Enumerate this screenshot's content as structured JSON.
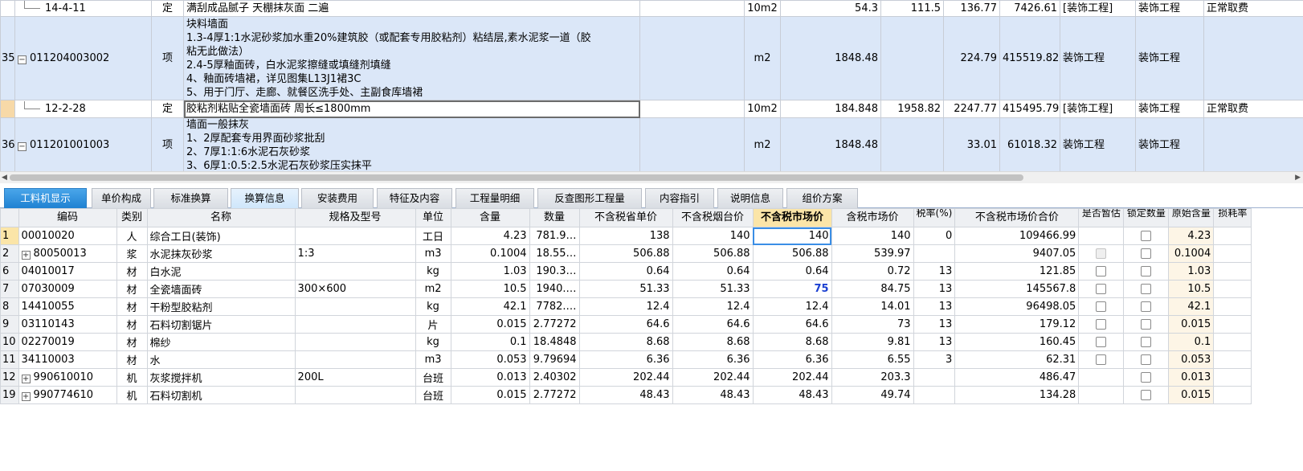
{
  "top_grid": {
    "rows": [
      {
        "idx": "",
        "code": "14-4-11",
        "kind": "定",
        "name": [
          "满刮成品腻子 天棚抹灰面 二遍"
        ],
        "unit": "10m2",
        "qty": "54.3",
        "price": "111.5",
        "total_unit": "136.77",
        "total": "7426.61",
        "category": "[装饰工程]",
        "major": "装饰工程",
        "fee": "正常取费",
        "style": "white",
        "tree": "line"
      },
      {
        "idx": "35",
        "code": "011204003002",
        "kind": "项",
        "name": [
          "块料墙面",
          "1.3-4厚1:1水泥砂浆加水重20%建筑胶（或配套专用胶粘剂）粘结层,素水泥浆一道（胶",
          "粘无此做法）",
          "2.4-5厚釉面砖，白水泥浆擦缝或填缝剂填缝",
          "4、釉面砖墙裙，详见图集L13J1裙3C",
          "5、用于门厅、走廊、就餐区洗手处、主副食库墙裙"
        ],
        "unit": "m2",
        "qty": "1848.48",
        "price": "",
        "total_unit": "224.79",
        "total": "415519.82",
        "category": "装饰工程",
        "major": "装饰工程",
        "fee": "",
        "style": "blue",
        "tree": "minus"
      },
      {
        "idx": "",
        "code": "12-2-28",
        "kind": "定",
        "name": [
          "胶粘剂粘贴全瓷墙面砖 周长≤1800mm"
        ],
        "unit": "10m2",
        "qty": "184.848",
        "price": "1958.82",
        "total_unit": "2247.77",
        "total": "415495.79",
        "category": "[装饰工程]",
        "major": "装饰工程",
        "fee": "正常取费",
        "style": "white",
        "tree": "line"
      },
      {
        "idx": "36",
        "code": "011201001003",
        "kind": "项",
        "name": [
          "墙面一般抹灰",
          "1、2厚配套专用界面砂浆批刮",
          "2、7厚1:1:6水泥石灰砂浆",
          "3、6厚1:0.5:2.5水泥石灰砂浆压实抹平"
        ],
        "unit": "m2",
        "qty": "1848.48",
        "price": "",
        "total_unit": "33.01",
        "total": "61018.32",
        "category": "装饰工程",
        "major": "装饰工程",
        "fee": "",
        "style": "blue",
        "tree": "minus"
      }
    ]
  },
  "tabs": [
    {
      "label": "工料机显示",
      "state": "active"
    },
    {
      "label": "单价构成",
      "state": ""
    },
    {
      "label": "标准换算",
      "state": ""
    },
    {
      "label": "换算信息",
      "state": "light"
    },
    {
      "label": "安装费用",
      "state": ""
    },
    {
      "label": "特征及内容",
      "state": ""
    },
    {
      "label": "工程量明细",
      "state": ""
    },
    {
      "label": "反查图形工程量",
      "state": ""
    },
    {
      "label": "内容指引",
      "state": ""
    },
    {
      "label": "说明信息",
      "state": ""
    },
    {
      "label": "组价方案",
      "state": ""
    }
  ],
  "bottom_grid": {
    "headers": [
      "",
      "编码",
      "类别",
      "名称",
      "规格及型号",
      "单位",
      "含量",
      "数量",
      "不含税省单价",
      "不含税烟台价",
      "不含税市场价",
      "含税市场价",
      "税率(%)",
      "不含税市场价合价",
      "是否暂估",
      "锁定数量",
      "原始含量",
      "损耗率"
    ],
    "rows": [
      {
        "n": "1",
        "code": "00010020",
        "plus": false,
        "cat": "人",
        "name": "综合工日(装饰)",
        "spec": "",
        "unit": "工日",
        "content": "4.23",
        "qty": "781.9…",
        "prov": "138",
        "yt": "140",
        "mkt": "140",
        "mkt_tax": "140",
        "rate": "0",
        "total": "109466.99",
        "est": "none",
        "lock": "box",
        "orig": "4.23"
      },
      {
        "n": "2",
        "code": "80050013",
        "plus": true,
        "cat": "浆",
        "name": "水泥抹灰砂浆",
        "spec": "1:3",
        "unit": "m3",
        "content": "0.1004",
        "qty": "18.55…",
        "prov": "506.88",
        "yt": "506.88",
        "mkt": "506.88",
        "mkt_tax": "539.97",
        "rate": "",
        "total": "9407.05",
        "est": "dis",
        "lock": "box",
        "orig": "0.1004"
      },
      {
        "n": "6",
        "code": "04010017",
        "plus": false,
        "cat": "材",
        "name": "白水泥",
        "spec": "",
        "unit": "kg",
        "content": "1.03",
        "qty": "190.3…",
        "prov": "0.64",
        "yt": "0.64",
        "mkt": "0.64",
        "mkt_tax": "0.72",
        "rate": "13",
        "total": "121.85",
        "est": "box",
        "lock": "box",
        "orig": "1.03"
      },
      {
        "n": "7",
        "code": "07030009",
        "plus": false,
        "cat": "材",
        "name": "全瓷墙面砖",
        "spec": "300×600",
        "unit": "m2",
        "content": "10.5",
        "qty": "1940.…",
        "prov": "51.33",
        "yt": "51.33",
        "mkt": "75",
        "mkt_tax": "84.75",
        "rate": "13",
        "total": "145567.8",
        "est": "box",
        "lock": "box",
        "orig": "10.5"
      },
      {
        "n": "8",
        "code": "14410055",
        "plus": false,
        "cat": "材",
        "name": "干粉型胶粘剂",
        "spec": "",
        "unit": "kg",
        "content": "42.1",
        "qty": "7782.…",
        "prov": "12.4",
        "yt": "12.4",
        "mkt": "12.4",
        "mkt_tax": "14.01",
        "rate": "13",
        "total": "96498.05",
        "est": "box",
        "lock": "box",
        "orig": "42.1"
      },
      {
        "n": "9",
        "code": "03110143",
        "plus": false,
        "cat": "材",
        "name": "石料切割锯片",
        "spec": "",
        "unit": "片",
        "content": "0.015",
        "qty": "2.77272",
        "prov": "64.6",
        "yt": "64.6",
        "mkt": "64.6",
        "mkt_tax": "73",
        "rate": "13",
        "total": "179.12",
        "est": "box",
        "lock": "box",
        "orig": "0.015"
      },
      {
        "n": "10",
        "code": "02270019",
        "plus": false,
        "cat": "材",
        "name": "棉纱",
        "spec": "",
        "unit": "kg",
        "content": "0.1",
        "qty": "18.4848",
        "prov": "8.68",
        "yt": "8.68",
        "mkt": "8.68",
        "mkt_tax": "9.81",
        "rate": "13",
        "total": "160.45",
        "est": "box",
        "lock": "box",
        "orig": "0.1"
      },
      {
        "n": "11",
        "code": "34110003",
        "plus": false,
        "cat": "材",
        "name": "水",
        "spec": "",
        "unit": "m3",
        "content": "0.053",
        "qty": "9.79694",
        "prov": "6.36",
        "yt": "6.36",
        "mkt": "6.36",
        "mkt_tax": "6.55",
        "rate": "3",
        "total": "62.31",
        "est": "box",
        "lock": "box",
        "orig": "0.053"
      },
      {
        "n": "12",
        "code": "990610010",
        "plus": true,
        "cat": "机",
        "name": "灰浆搅拌机",
        "spec": "200L",
        "unit": "台班",
        "content": "0.013",
        "qty": "2.40302",
        "prov": "202.44",
        "yt": "202.44",
        "mkt": "202.44",
        "mkt_tax": "203.3",
        "rate": "",
        "total": "486.47",
        "est": "none",
        "lock": "box",
        "orig": "0.013"
      },
      {
        "n": "19",
        "code": "990774610",
        "plus": true,
        "cat": "机",
        "name": "石料切割机",
        "spec": "",
        "unit": "台班",
        "content": "0.015",
        "qty": "2.77272",
        "prov": "48.43",
        "yt": "48.43",
        "mkt": "48.43",
        "mkt_tax": "49.74",
        "rate": "",
        "total": "134.28",
        "est": "none",
        "lock": "box",
        "orig": "0.015"
      }
    ]
  }
}
